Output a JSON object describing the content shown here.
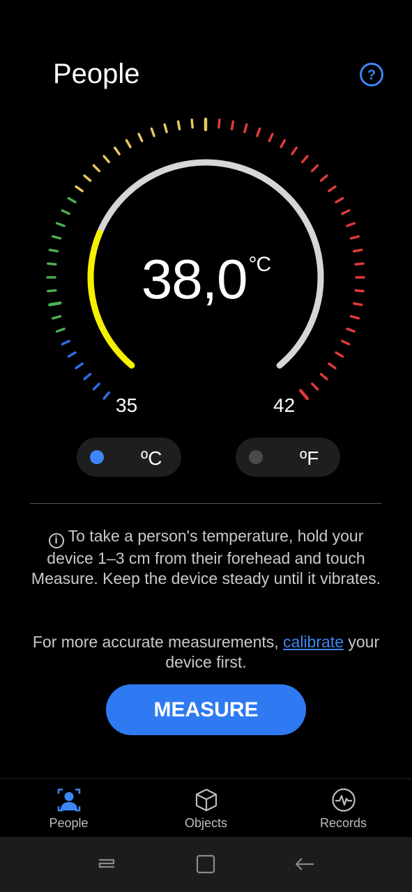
{
  "header": {
    "title": "People",
    "help_icon": "help-icon"
  },
  "gauge": {
    "value": "38,0",
    "unit": "°C",
    "min_label": "35",
    "max_label": "42",
    "fill_fraction": 0.26,
    "colors": {
      "fill": "#f5f000",
      "track": "#d6d6d6",
      "blue": "#2f6ee0",
      "green": "#4caf50",
      "yellow": "#e6c860",
      "red": "#e03a3a"
    }
  },
  "units": {
    "celsius": {
      "label": "ºC",
      "selected": true,
      "dot_color": "#3d86f5"
    },
    "fahrenheit": {
      "label": "ºF",
      "selected": false,
      "dot_color": "#4a4a4a"
    }
  },
  "instructions": "To take a person's temperature, hold your device 1–3 cm from their forehead and touch Measure. Keep the device steady until it vibrates.",
  "calibration": {
    "before": "For more accurate measurements, ",
    "link": "calibrate",
    "after": " your device first."
  },
  "measure_button": "MEASURE",
  "nav": [
    {
      "label": "People",
      "icon": "person-icon",
      "active": true
    },
    {
      "label": "Objects",
      "icon": "cube-icon",
      "active": false
    },
    {
      "label": "Records",
      "icon": "pulse-icon",
      "active": false
    }
  ],
  "system_nav": [
    "recent-apps-icon",
    "home-icon",
    "back-icon"
  ]
}
